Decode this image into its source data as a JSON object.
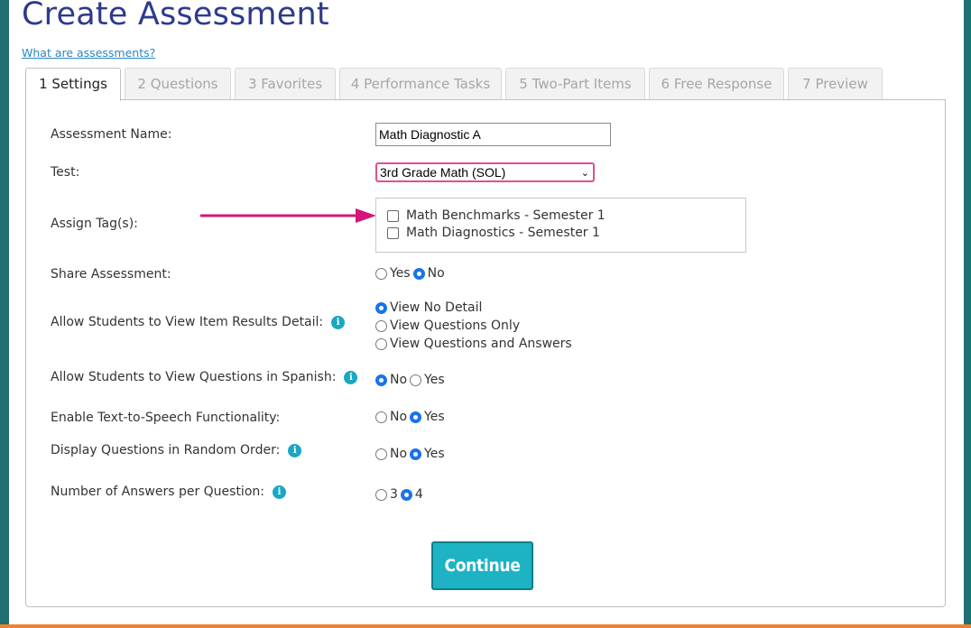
{
  "page": {
    "title": "Create Assessment",
    "help_link": "What are assessments?"
  },
  "tabs": [
    {
      "label": "1 Settings",
      "active": true
    },
    {
      "label": "2 Questions",
      "active": false
    },
    {
      "label": "3 Favorites",
      "active": false
    },
    {
      "label": "4 Performance Tasks",
      "active": false
    },
    {
      "label": "5 Two-Part Items",
      "active": false
    },
    {
      "label": "6 Free Response",
      "active": false
    },
    {
      "label": "7 Preview",
      "active": false
    }
  ],
  "form": {
    "name_label": "Assessment Name:",
    "name_value": "Math Diagnostic A",
    "test_label": "Test:",
    "test_value": "3rd Grade Math (SOL)",
    "tags_label": "Assign Tag(s):",
    "tags": [
      {
        "label": "Math Benchmarks - Semester 1",
        "checked": false
      },
      {
        "label": "Math Diagnostics - Semester 1",
        "checked": false
      }
    ],
    "share_label": "Share Assessment:",
    "share_options": [
      "Yes",
      "No"
    ],
    "share_selected": "No",
    "item_results_label": "Allow Students to View Item Results Detail:",
    "item_results_options": [
      "View No Detail",
      "View Questions Only",
      "View Questions and Answers"
    ],
    "item_results_selected": "View No Detail",
    "spanish_label": "Allow Students to View Questions in Spanish:",
    "spanish_options": [
      "No",
      "Yes"
    ],
    "spanish_selected": "No",
    "tts_label": "Enable Text-to-Speech Functionality:",
    "tts_options": [
      "No",
      "Yes"
    ],
    "tts_selected": "Yes",
    "random_label": "Display Questions in Random Order:",
    "random_options": [
      "No",
      "Yes"
    ],
    "random_selected": "Yes",
    "answers_label": "Number of Answers per Question:",
    "answers_options": [
      "3",
      "4"
    ],
    "answers_selected": "4",
    "continue_label": "Continue"
  },
  "colors": {
    "title": "#2d3a8c",
    "accent": "#1db3c4",
    "arrow": "#d4157a",
    "frame": "#1f6f74"
  },
  "icons": {
    "info": "info-icon",
    "arrow": "arrow-annotation"
  }
}
